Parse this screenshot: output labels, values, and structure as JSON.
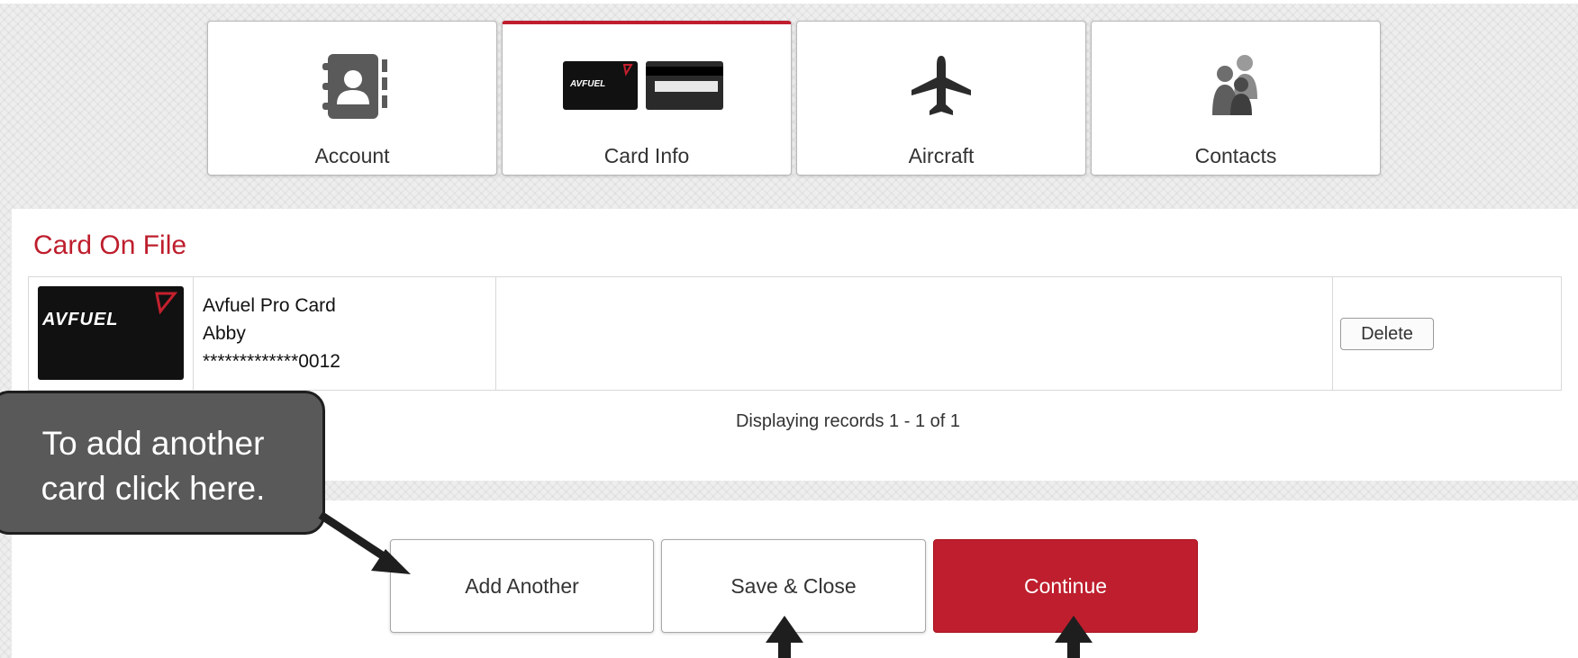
{
  "tabs": [
    {
      "label": "Account",
      "icon": "address-book-icon",
      "active": false
    },
    {
      "label": "Card Info",
      "icon": "credit-card-icon",
      "active": true
    },
    {
      "label": "Aircraft",
      "icon": "airplane-icon",
      "active": false
    },
    {
      "label": "Contacts",
      "icon": "people-icon",
      "active": false
    }
  ],
  "card_panel": {
    "title": "Card On File",
    "card": {
      "brand": "AVFUEL",
      "name": "Avfuel Pro Card",
      "holder": "Abby",
      "number": "*************0012"
    },
    "delete_label": "Delete",
    "records_text": "Displaying records 1 - 1 of 1"
  },
  "actions": {
    "add_label": "Add Another",
    "save_label": "Save & Close",
    "continue_label": "Continue"
  },
  "callout": {
    "line1": "To add another",
    "line2": "card click here."
  },
  "colors": {
    "accent": "#be1e2d",
    "callout_bg": "#595959"
  }
}
